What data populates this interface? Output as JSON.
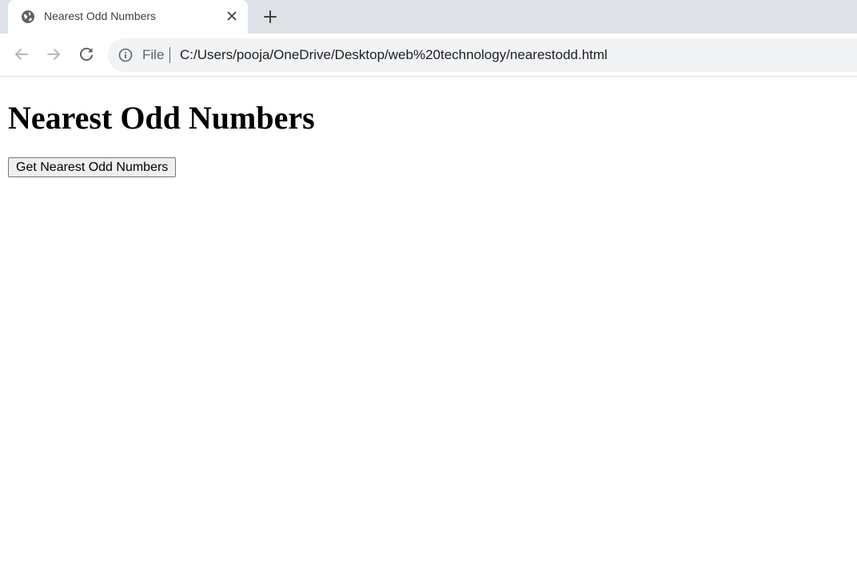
{
  "browser": {
    "tab": {
      "title": "Nearest Odd Numbers",
      "favicon": "globe-icon",
      "close_icon": "close-icon"
    },
    "new_tab_icon": "plus-icon",
    "nav": {
      "back_icon": "arrow-left-icon",
      "forward_icon": "arrow-right-icon",
      "reload_icon": "reload-icon"
    },
    "omnibox": {
      "info_icon": "info-icon",
      "scheme_label": "File",
      "url": "C:/Users/pooja/OneDrive/Desktop/web%20technology/nearestodd.html"
    }
  },
  "page": {
    "heading": "Nearest Odd Numbers",
    "button_label": "Get Nearest Odd Numbers"
  },
  "colors": {
    "tabstrip_bg": "#dee1e6",
    "omnibox_bg": "#f1f3f4",
    "icon_gray": "#5f6368",
    "icon_disabled": "#b5b8bd"
  }
}
